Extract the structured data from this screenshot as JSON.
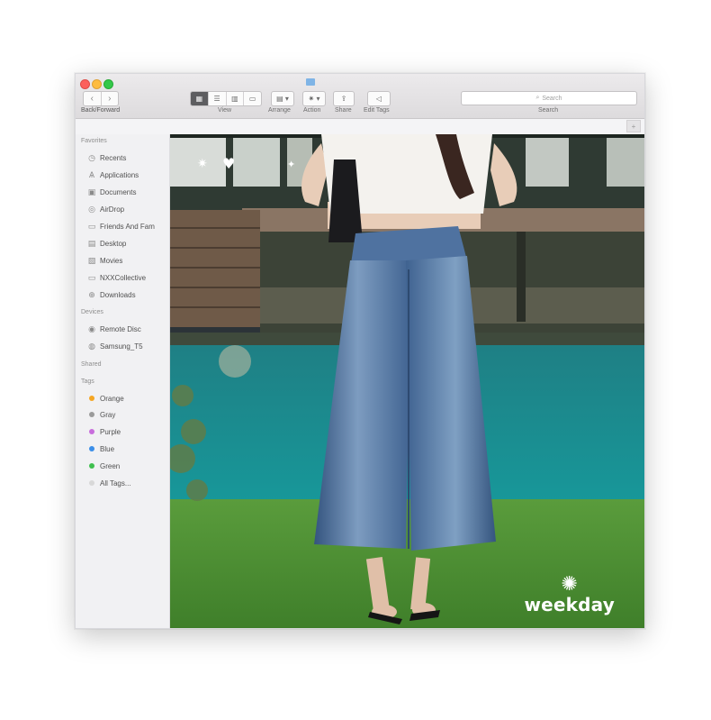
{
  "window": {
    "title_icon": "folder-icon"
  },
  "toolbar": {
    "path_label": "Back/Forward",
    "view_label": "View",
    "arrange_label": "Arrange",
    "action_label": "Action",
    "share_label": "Share",
    "edit_tags_label": "Edit Tags",
    "search_label": "Search",
    "search_placeholder": "Search"
  },
  "sidebar": {
    "favorites_header": "Favorites",
    "favorites": [
      {
        "label": "Recents",
        "icon": "clock-icon"
      },
      {
        "label": "Applications",
        "icon": "applications-icon"
      },
      {
        "label": "Documents",
        "icon": "document-icon"
      },
      {
        "label": "AirDrop",
        "icon": "airdrop-icon"
      },
      {
        "label": "Friends And Fam",
        "icon": "folder-icon"
      },
      {
        "label": "Desktop",
        "icon": "desktop-icon"
      },
      {
        "label": "Movies",
        "icon": "film-icon"
      },
      {
        "label": "NXXCollective",
        "icon": "folder-icon"
      },
      {
        "label": "Downloads",
        "icon": "download-icon"
      }
    ],
    "devices_header": "Devices",
    "devices": [
      {
        "label": "Remote Disc",
        "icon": "disc-icon"
      },
      {
        "label": "Samsung_T5",
        "icon": "drive-icon"
      }
    ],
    "shared_header": "Shared",
    "tags_header": "Tags",
    "tags": [
      {
        "label": "Orange",
        "color": "#f5a623"
      },
      {
        "label": "Gray",
        "color": "#9b9b9b"
      },
      {
        "label": "Purple",
        "color": "#c86ddc"
      },
      {
        "label": "Blue",
        "color": "#3b8ee8"
      },
      {
        "label": "Green",
        "color": "#3fbf4f"
      },
      {
        "label": "All Tags...",
        "color": "#d8d8d8"
      }
    ]
  },
  "content": {
    "brand_text": "weekday",
    "colors": {
      "denim": "#4a6f9c",
      "pool": "#1c8a8c",
      "grass": "#4f8f35",
      "shirt": "#f4f2ee"
    }
  }
}
